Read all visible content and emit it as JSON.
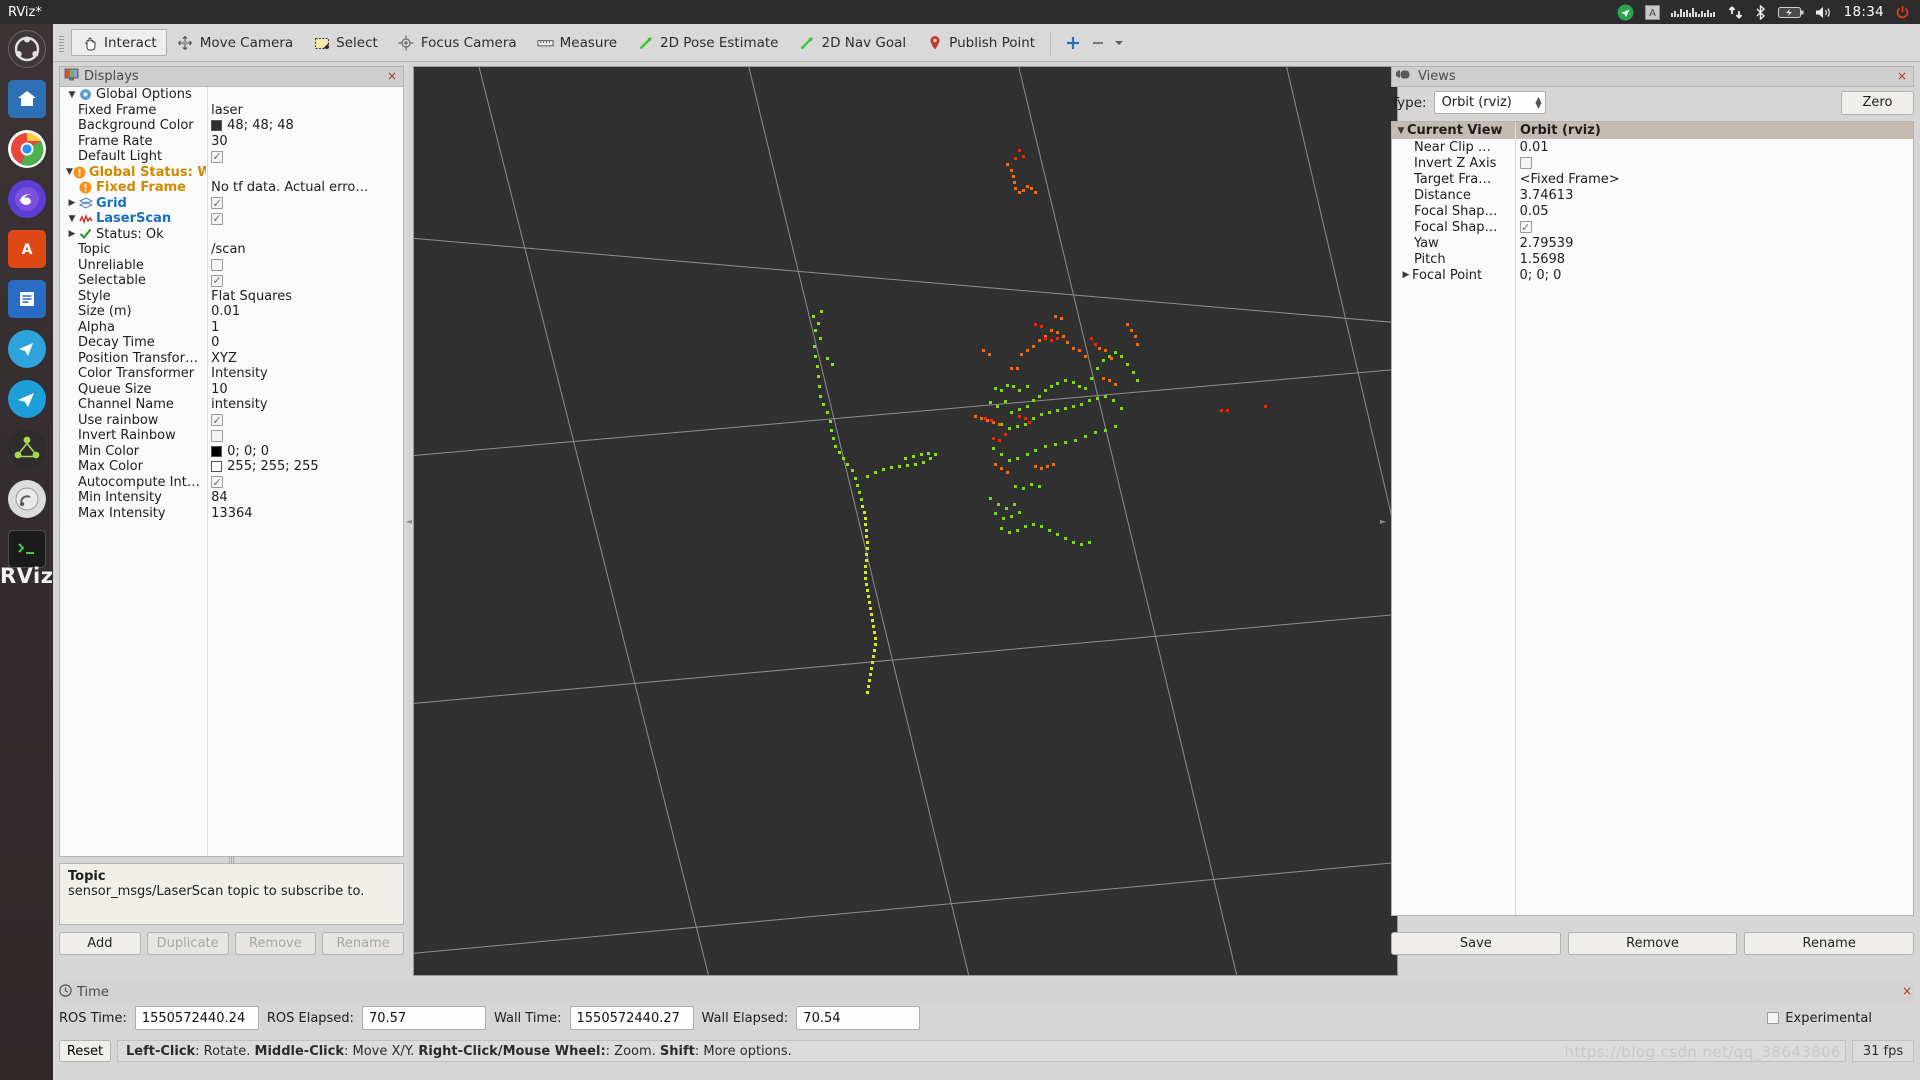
{
  "system_bar": {
    "app_title": "RViz*",
    "clock": "18:34",
    "tray_icons": [
      "telegram-icon",
      "keyboard-layout-icon",
      "sound-meter-icon",
      "network-icon",
      "bluetooth-icon",
      "battery-icon",
      "volume-icon",
      "power-icon"
    ]
  },
  "dock": {
    "label": "RViz",
    "items": [
      {
        "name": "ubuntu-dash-icon",
        "color": "#3b3334"
      },
      {
        "name": "files-icon",
        "color": "#2c6fbd"
      },
      {
        "name": "chrome-icon",
        "color": "#e8453c"
      },
      {
        "name": "firefox-icon",
        "color": "#6a4fd8"
      },
      {
        "name": "software-center-icon",
        "color": "#dd4814"
      },
      {
        "name": "libreoffice-writer-icon",
        "color": "#2a6cc4"
      },
      {
        "name": "telegram-icon",
        "color": "#34a0d8"
      },
      {
        "name": "telegram-alt-icon",
        "color": "#1f9fd8"
      },
      {
        "name": "ros-icon",
        "color": "#8ec63f"
      },
      {
        "name": "gazebo-icon",
        "color": "#e0e0e0"
      },
      {
        "name": "terminal-icon",
        "color": "#1f1f1f"
      }
    ]
  },
  "toolbar": {
    "items": [
      {
        "label": "Interact",
        "icon": "hand-cursor-icon",
        "active": true
      },
      {
        "label": "Move Camera",
        "icon": "move-camera-icon",
        "active": false
      },
      {
        "label": "Select",
        "icon": "select-rect-icon",
        "active": false
      },
      {
        "label": "Focus Camera",
        "icon": "focus-camera-icon",
        "active": false
      },
      {
        "label": "Measure",
        "icon": "ruler-icon",
        "active": false
      },
      {
        "label": "2D Pose Estimate",
        "icon": "pose-arrow-icon",
        "active": false
      },
      {
        "label": "2D Nav Goal",
        "icon": "nav-goal-arrow-icon",
        "active": false
      },
      {
        "label": "Publish Point",
        "icon": "map-pin-icon",
        "active": false
      }
    ],
    "extra_icons": [
      "add-tool-icon",
      "remove-tool-icon",
      "tool-menu-chevron-icon"
    ]
  },
  "displays_panel": {
    "title": "Displays",
    "title_icon": "displays-icon",
    "close_icon": "×",
    "rows": [
      {
        "indent": 0,
        "arrow": "▼",
        "icon": "gear-icon",
        "label": "Global Options",
        "value": "",
        "style": "plain",
        "value_type": "text"
      },
      {
        "indent": 1,
        "arrow": "",
        "icon": "",
        "label": "Fixed Frame",
        "value": "laser",
        "style": "plain",
        "value_type": "text"
      },
      {
        "indent": 1,
        "arrow": "",
        "icon": "",
        "label": "Background Color",
        "value": "48; 48; 48",
        "style": "plain",
        "value_type": "swatch",
        "swatch": "#303030"
      },
      {
        "indent": 1,
        "arrow": "",
        "icon": "",
        "label": "Frame Rate",
        "value": "30",
        "style": "plain",
        "value_type": "text"
      },
      {
        "indent": 1,
        "arrow": "",
        "icon": "",
        "label": "Default Light",
        "value": "",
        "style": "plain",
        "value_type": "checked"
      },
      {
        "indent": 0,
        "arrow": "▼",
        "icon": "warning-icon",
        "label": "Global Status: W...",
        "value": "",
        "style": "orange",
        "value_type": "text"
      },
      {
        "indent": 1,
        "arrow": "",
        "icon": "warning-icon",
        "label": "Fixed Frame",
        "value": "No tf data.  Actual erro…",
        "style": "orange",
        "value_type": "text"
      },
      {
        "indent": 0,
        "arrow": "▶",
        "icon": "grid-icon",
        "label": "Grid",
        "value": "",
        "style": "blue",
        "value_type": "checked"
      },
      {
        "indent": 0,
        "arrow": "▼",
        "icon": "laserscan-icon",
        "label": "LaserScan",
        "value": "",
        "style": "blue",
        "value_type": "checked"
      },
      {
        "indent": 1,
        "arrow": "▶",
        "icon": "check-icon",
        "label": "Status: Ok",
        "value": "",
        "style": "plain",
        "value_type": "text"
      },
      {
        "indent": 1,
        "arrow": "",
        "icon": "",
        "label": "Topic",
        "value": "/scan",
        "style": "plain",
        "value_type": "text"
      },
      {
        "indent": 1,
        "arrow": "",
        "icon": "",
        "label": "Unreliable",
        "value": "",
        "style": "plain",
        "value_type": "unchecked"
      },
      {
        "indent": 1,
        "arrow": "",
        "icon": "",
        "label": "Selectable",
        "value": "",
        "style": "plain",
        "value_type": "checked"
      },
      {
        "indent": 1,
        "arrow": "",
        "icon": "",
        "label": "Style",
        "value": "Flat Squares",
        "style": "plain",
        "value_type": "text"
      },
      {
        "indent": 1,
        "arrow": "",
        "icon": "",
        "label": "Size (m)",
        "value": "0.01",
        "style": "plain",
        "value_type": "text"
      },
      {
        "indent": 1,
        "arrow": "",
        "icon": "",
        "label": "Alpha",
        "value": "1",
        "style": "plain",
        "value_type": "text"
      },
      {
        "indent": 1,
        "arrow": "",
        "icon": "",
        "label": "Decay Time",
        "value": "0",
        "style": "plain",
        "value_type": "text"
      },
      {
        "indent": 1,
        "arrow": "",
        "icon": "",
        "label": "Position Transfor…",
        "value": "XYZ",
        "style": "plain",
        "value_type": "text"
      },
      {
        "indent": 1,
        "arrow": "",
        "icon": "",
        "label": "Color Transformer",
        "value": "Intensity",
        "style": "plain",
        "value_type": "text"
      },
      {
        "indent": 1,
        "arrow": "",
        "icon": "",
        "label": "Queue Size",
        "value": "10",
        "style": "plain",
        "value_type": "text"
      },
      {
        "indent": 1,
        "arrow": "",
        "icon": "",
        "label": "Channel Name",
        "value": "intensity",
        "style": "plain",
        "value_type": "text"
      },
      {
        "indent": 1,
        "arrow": "",
        "icon": "",
        "label": "Use rainbow",
        "value": "",
        "style": "plain",
        "value_type": "checked"
      },
      {
        "indent": 1,
        "arrow": "",
        "icon": "",
        "label": "Invert Rainbow",
        "value": "",
        "style": "plain",
        "value_type": "unchecked"
      },
      {
        "indent": 1,
        "arrow": "",
        "icon": "",
        "label": "Min Color",
        "value": "0; 0; 0",
        "style": "plain",
        "value_type": "swatch",
        "swatch": "#000000"
      },
      {
        "indent": 1,
        "arrow": "",
        "icon": "",
        "label": "Max Color",
        "value": "255; 255; 255",
        "style": "plain",
        "value_type": "swatch",
        "swatch": "#ffffff"
      },
      {
        "indent": 1,
        "arrow": "",
        "icon": "",
        "label": "Autocompute Int…",
        "value": "",
        "style": "plain",
        "value_type": "checked"
      },
      {
        "indent": 1,
        "arrow": "",
        "icon": "",
        "label": "Min Intensity",
        "value": "84",
        "style": "plain",
        "value_type": "text"
      },
      {
        "indent": 1,
        "arrow": "",
        "icon": "",
        "label": "Max Intensity",
        "value": "13364",
        "style": "plain",
        "value_type": "text"
      }
    ],
    "help": {
      "title": "Topic",
      "text": "sensor_msgs/LaserScan topic to subscribe to."
    },
    "buttons": [
      {
        "label": "Add",
        "enabled": true
      },
      {
        "label": "Duplicate",
        "enabled": false
      },
      {
        "label": "Remove",
        "enabled": false
      },
      {
        "label": "Rename",
        "enabled": false
      }
    ]
  },
  "views_panel": {
    "title": "Views",
    "title_icon": "views-icon",
    "close_icon": "×",
    "type_label": "Type:",
    "type_value": "Orbit (rviz)",
    "zero_label": "Zero",
    "header": {
      "left": "Current View",
      "right": "Orbit (rviz)"
    },
    "rows": [
      {
        "label": "Near Clip …",
        "value": "0.01",
        "value_type": "text"
      },
      {
        "label": "Invert Z Axis",
        "value": "",
        "value_type": "unchecked"
      },
      {
        "label": "Target Fra…",
        "value": "<Fixed Frame>",
        "value_type": "text"
      },
      {
        "label": "Distance",
        "value": "3.74613",
        "value_type": "text"
      },
      {
        "label": "Focal Shap…",
        "value": "0.05",
        "value_type": "text"
      },
      {
        "label": "Focal Shap…",
        "value": "",
        "value_type": "checked"
      },
      {
        "label": "Yaw",
        "value": "2.79539",
        "value_type": "text"
      },
      {
        "label": "Pitch",
        "value": "1.5698",
        "value_type": "text"
      },
      {
        "label": "Focal Point",
        "value": "0; 0; 0",
        "value_type": "text",
        "arrow": "▶"
      }
    ],
    "buttons": [
      {
        "label": "Save",
        "enabled": true
      },
      {
        "label": "Remove",
        "enabled": true
      },
      {
        "label": "Rename",
        "enabled": true
      }
    ]
  },
  "time_panel": {
    "title": "Time",
    "title_icon": "clock-icon",
    "close_icon": "×",
    "fields": [
      {
        "label": "ROS Time:",
        "value": "1550572440.24"
      },
      {
        "label": "ROS Elapsed:",
        "value": "70.57"
      },
      {
        "label": "Wall Time:",
        "value": "1550572440.27"
      },
      {
        "label": "Wall Elapsed:",
        "value": "70.54"
      }
    ],
    "experimental_label": "Experimental",
    "experimental_checked": false
  },
  "status_bar": {
    "reset_label": "Reset",
    "hint_segments": [
      {
        "text": "Left-Click",
        "bold": true
      },
      {
        "text": ": Rotate.  ",
        "bold": false
      },
      {
        "text": "Middle-Click",
        "bold": true
      },
      {
        "text": ": Move X/Y.  ",
        "bold": false
      },
      {
        "text": "Right-Click/Mouse Wheel:",
        "bold": true
      },
      {
        "text": ": Zoom.  ",
        "bold": false
      },
      {
        "text": "Shift",
        "bold": true
      },
      {
        "text": ": More options.",
        "bold": false
      }
    ],
    "watermark": "https://blog.csdn.net/qq_38643806",
    "fps": "31 fps"
  },
  "colors": {
    "viewport_bg": "#303030",
    "grid_line": "#9e9e9e",
    "point_green": "#6fe01a",
    "point_yellow": "#e8e81a",
    "point_orange": "#f06a10",
    "point_red": "#e82a0a",
    "accent_blue": "#1a6fc4",
    "warn_orange": "#d08a00"
  }
}
